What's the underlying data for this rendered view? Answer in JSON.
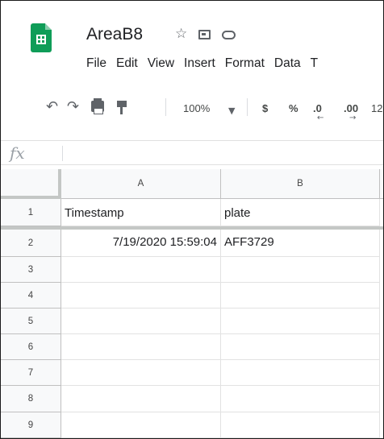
{
  "header": {
    "doc_title": "AreaB8",
    "icons": [
      "star-icon",
      "move-to-folder-icon",
      "cloud-status-icon"
    ],
    "logo": "google-sheets-logo",
    "brand_color": "#0f9d58"
  },
  "menu": {
    "items": [
      "File",
      "Edit",
      "View",
      "Insert",
      "Format",
      "Data",
      "T"
    ]
  },
  "toolbar": {
    "icons": [
      "undo-icon",
      "redo-icon",
      "print-icon",
      "paint-format-icon"
    ],
    "zoom": "100%",
    "currency": "$",
    "percent": "%",
    "decrease_decimal": ".0",
    "increase_decimal": ".00",
    "more_formats": "12"
  },
  "formula_bar": {
    "fx_label": "fx",
    "value": ""
  },
  "sheet": {
    "columns": [
      "A",
      "B"
    ],
    "rows": [
      {
        "num": "1",
        "cells": [
          "Timestamp",
          "plate"
        ]
      },
      {
        "num": "2",
        "cells": [
          "7/19/2020 15:59:04",
          "AFF3729"
        ]
      },
      {
        "num": "3",
        "cells": [
          "",
          ""
        ]
      },
      {
        "num": "4",
        "cells": [
          "",
          ""
        ]
      },
      {
        "num": "5",
        "cells": [
          "",
          ""
        ]
      },
      {
        "num": "6",
        "cells": [
          "",
          ""
        ]
      },
      {
        "num": "7",
        "cells": [
          "",
          ""
        ]
      },
      {
        "num": "8",
        "cells": [
          "",
          ""
        ]
      },
      {
        "num": "9",
        "cells": [
          "",
          ""
        ]
      }
    ]
  }
}
